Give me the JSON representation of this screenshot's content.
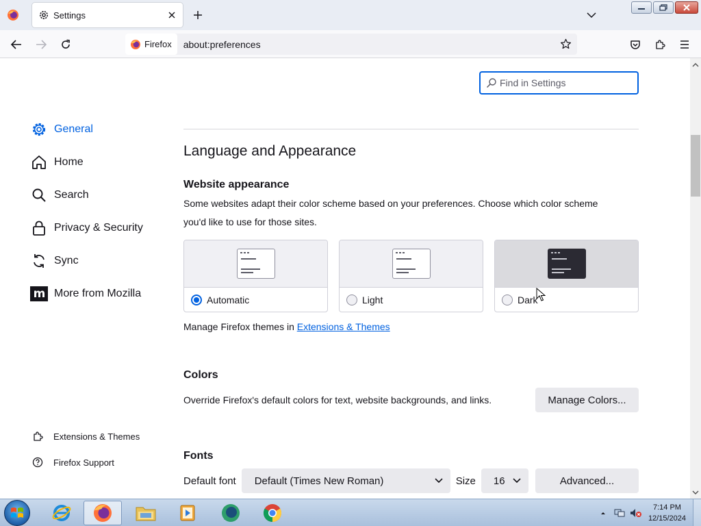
{
  "browser": {
    "tab_title": "Settings",
    "identity_label": "Firefox",
    "url": "about:preferences"
  },
  "search": {
    "placeholder": "Find in Settings"
  },
  "sidebar": {
    "items": [
      {
        "label": "General",
        "icon": "gear-icon",
        "active": true
      },
      {
        "label": "Home",
        "icon": "home-icon"
      },
      {
        "label": "Search",
        "icon": "search-icon"
      },
      {
        "label": "Privacy & Security",
        "icon": "lock-icon"
      },
      {
        "label": "Sync",
        "icon": "sync-icon"
      },
      {
        "label": "More from Mozilla",
        "icon": "mozilla-icon"
      }
    ],
    "footer": [
      {
        "label": "Extensions & Themes",
        "icon": "puzzle-icon"
      },
      {
        "label": "Firefox Support",
        "icon": "help-icon"
      }
    ]
  },
  "main": {
    "section_title": "Language and Appearance",
    "website_appearance": {
      "heading": "Website appearance",
      "description_line1": "Some websites adapt their color scheme based on your preferences. Choose which color scheme",
      "description_line2": "you'd like to use for those sites.",
      "options": [
        {
          "label": "Automatic",
          "selected": true
        },
        {
          "label": "Light",
          "selected": false
        },
        {
          "label": "Dark",
          "selected": false
        }
      ],
      "themes_prefix": "Manage Firefox themes in",
      "themes_link": "Extensions & Themes"
    },
    "colors": {
      "heading": "Colors",
      "description": "Override Firefox's default colors for text, website backgrounds, and links.",
      "button": "Manage Colors..."
    },
    "fonts": {
      "heading": "Fonts",
      "default_font_label": "Default font",
      "default_font_value": "Default (Times New Roman)",
      "size_label": "Size",
      "size_value": "16",
      "advanced_button": "Advanced..."
    }
  },
  "taskbar": {
    "time": "7:14 PM",
    "date": "12/15/2024"
  },
  "colors": {
    "accent": "#0061e0",
    "text": "#15141a",
    "button_bg": "#e9e9ed"
  }
}
